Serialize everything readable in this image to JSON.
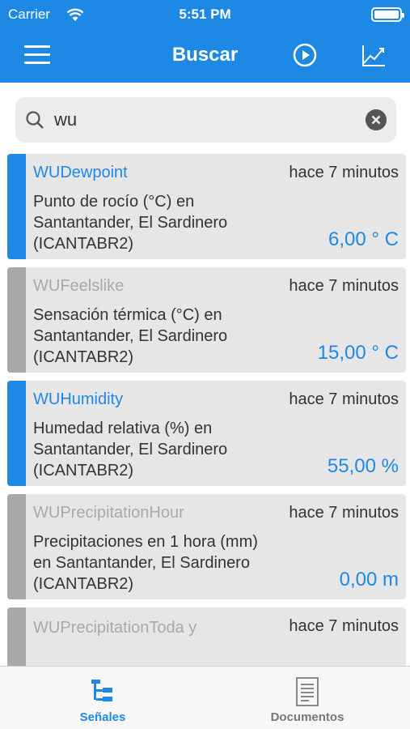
{
  "status_bar": {
    "carrier": "Carrier",
    "time": "5:51 PM"
  },
  "header": {
    "title": "Buscar",
    "menu_icon": "menu-icon",
    "play_icon": "play-circle-icon",
    "chart_icon": "line-chart-icon"
  },
  "search": {
    "value": "wu",
    "placeholder": ""
  },
  "signals": [
    {
      "name": "WUDewpoint",
      "ago": "hace 7 minutos",
      "description": "Punto de rocío (°C)  en Santantander, El Sardinero (ICANTABR2)",
      "value": "6,00 ° C",
      "active": true
    },
    {
      "name": "WUFeelslike",
      "ago": "hace 7 minutos",
      "description": "Sensación térmica (°C)  en Santantander, El Sardinero (ICANTABR2)",
      "value": "15,00 ° C",
      "active": false
    },
    {
      "name": "WUHumidity",
      "ago": "hace 7 minutos",
      "description": "Humedad relativa (%)  en Santantander, El Sardinero (ICANTABR2)",
      "value": "55,00 %",
      "active": true
    },
    {
      "name": "WUPrecipitationHour",
      "ago": "hace 7 minutos",
      "description": "Precipitaciones en 1 hora (mm)  en Santantander, El Sardinero (ICANTABR2)",
      "value": "0,00 m",
      "active": false
    },
    {
      "name": "WUPrecipitationToda y",
      "ago": "hace 7 minutos",
      "description": "",
      "value": "",
      "active": false
    }
  ],
  "tabs": {
    "senales": "Señales",
    "documentos": "Documentos"
  },
  "colors": {
    "accent": "#1e88e5",
    "inactive_bar": "#a8a8a8",
    "card_bg": "#e6e6e6"
  }
}
